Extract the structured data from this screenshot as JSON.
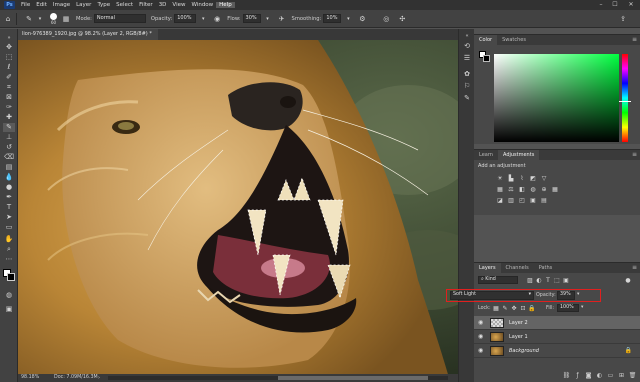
{
  "menubar": {
    "logo": "Ps",
    "items": [
      "File",
      "Edit",
      "Image",
      "Layer",
      "Type",
      "Select",
      "Filter",
      "3D",
      "View",
      "Window",
      "Help"
    ],
    "active_item": "Help",
    "window_controls": [
      "–",
      "☐",
      "✕"
    ]
  },
  "options": {
    "brush_size": "60",
    "mode_label": "Mode:",
    "mode_value": "Normal",
    "opacity_label": "Opacity:",
    "opacity_value": "100%",
    "flow_label": "Flow:",
    "flow_value": "30%",
    "smoothing_label": "Smoothing:",
    "smoothing_value": "10%"
  },
  "document": {
    "tab_title": "lion-976389_1920.jpg @ 98.2% (Layer 2, RGB/8#) *",
    "close": "×",
    "zoom": "98.18%",
    "doc_info": "Doc: 7.09M/16.3M"
  },
  "panels": {
    "color_tabs": [
      "Color",
      "Swatches"
    ],
    "learn_tabs": [
      "Learn",
      "Adjustments"
    ],
    "add_adjustment": "Add an adjustment",
    "layers_tabs": [
      "Layers",
      "Channels",
      "Paths"
    ],
    "kind_value": "Kind",
    "blend_mode": "Soft Light",
    "opacity_label": "Opacity:",
    "opacity_value": "39%",
    "lock_label": "Lock:",
    "fill_label": "Fill:",
    "fill_value": "100%",
    "layers": [
      {
        "name": "Layer 2",
        "active": true
      },
      {
        "name": "Layer 1",
        "active": false
      },
      {
        "name": "Background",
        "active": false
      }
    ]
  },
  "colors": {
    "highlight_border": "#e0201f",
    "active_tab": "#484848",
    "accent_green": "#00ff40"
  }
}
